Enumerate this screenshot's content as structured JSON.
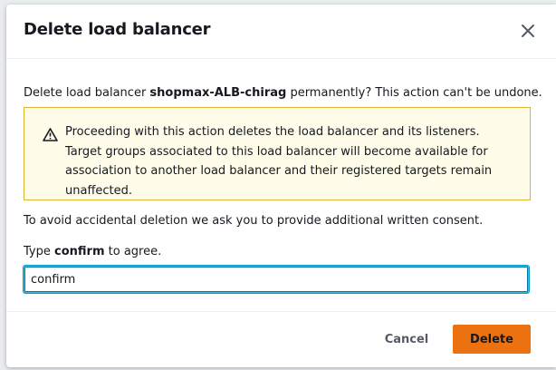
{
  "dialog": {
    "title": "Delete load balancer",
    "description_prefix": "Delete load balancer ",
    "load_balancer_name": "shopmax-ALB-chirag",
    "description_suffix": " permanently? This action can't be undone.",
    "alert": {
      "icon": "warning-icon",
      "message": "Proceeding with this action deletes the load balancer and its listeners. Target groups associated to this load balancer will become available for association to another load balancer and their registered targets remain unaffected."
    },
    "consent_text": "To avoid accidental deletion we ask you to provide additional written consent.",
    "type_prefix": "Type ",
    "confirm_word": "confirm",
    "type_suffix": " to agree.",
    "input_value": "confirm",
    "cancel_label": "Cancel",
    "delete_label": "Delete"
  },
  "colors": {
    "primary_button": "#ec7211",
    "alert_background": "#fffce9",
    "alert_border": "#dfb52c",
    "input_focus": "#0a74a8"
  }
}
